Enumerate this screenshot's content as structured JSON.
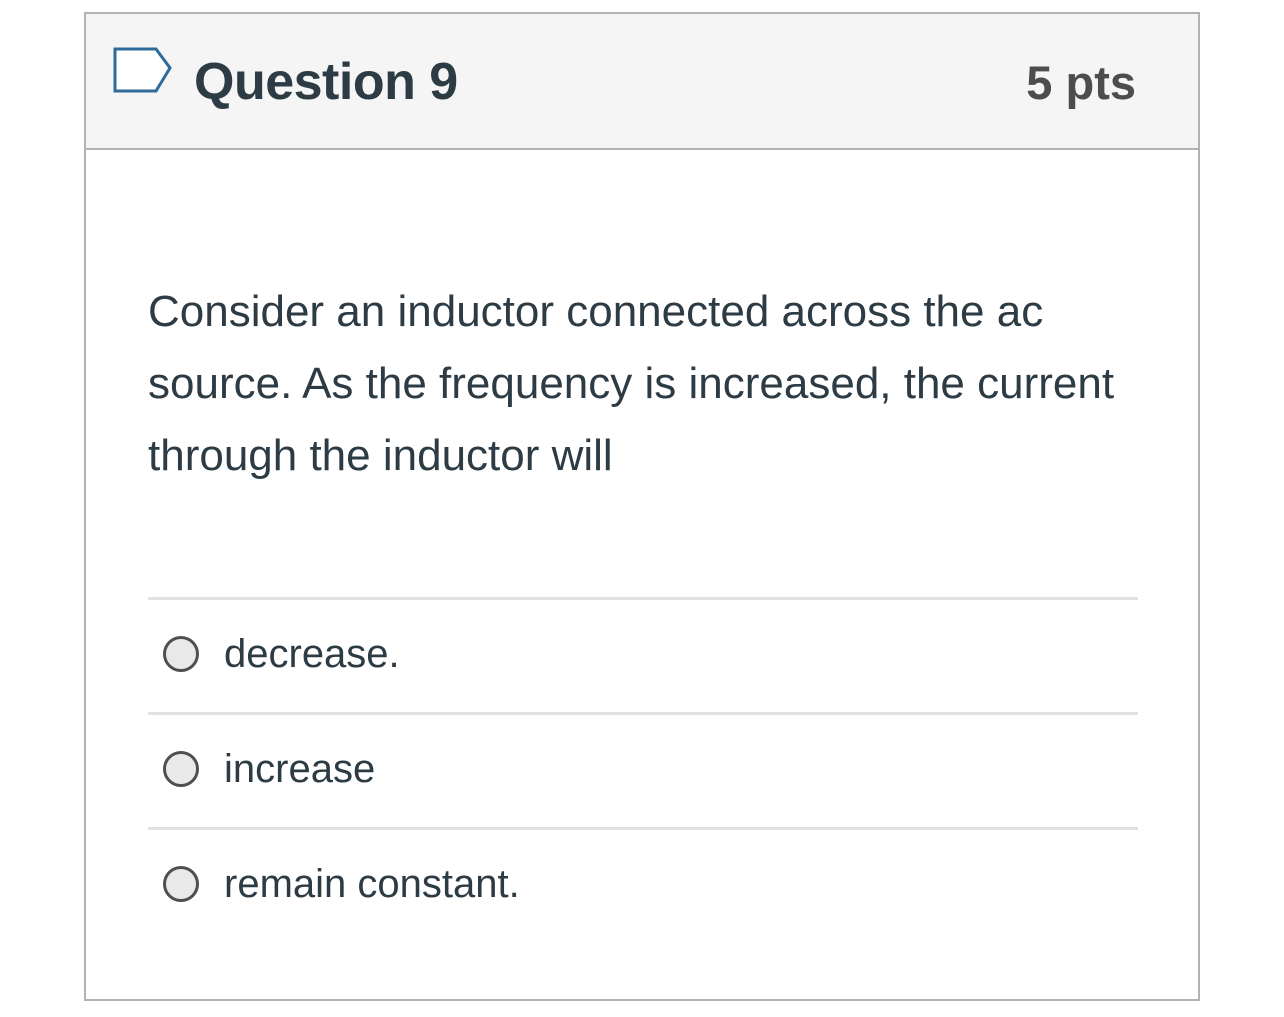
{
  "question": {
    "title": "Question 9",
    "points": "5 pts",
    "flag_icon": "flag-outline-icon",
    "text": "Consider an inductor connected across the ac source. As the frequency is increased, the current through the inductor will"
  },
  "answers": [
    {
      "label": "decrease.",
      "selected": false
    },
    {
      "label": "increase",
      "selected": false
    },
    {
      "label": "remain constant.",
      "selected": false
    }
  ],
  "colors": {
    "header_bg": "#f5f5f5",
    "border": "#b3b3b3",
    "text": "#2d3b45",
    "flag_stroke": "#2f6b9a"
  }
}
